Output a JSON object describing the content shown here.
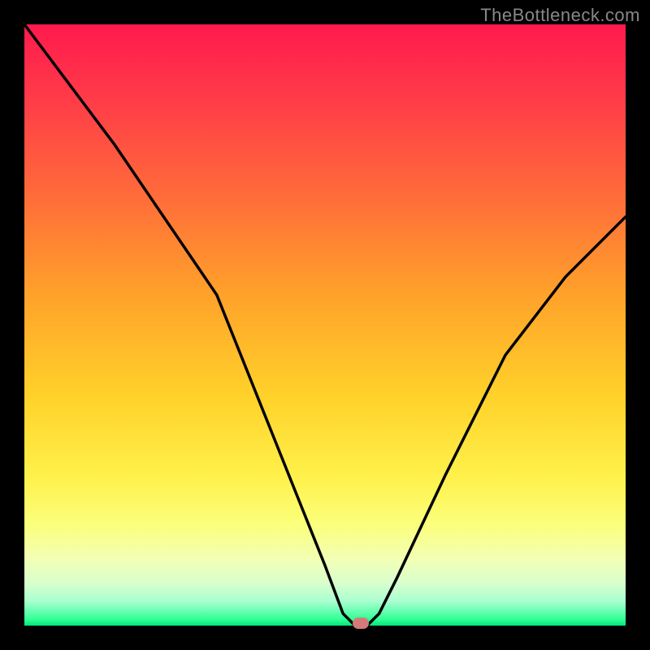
{
  "watermark": "TheBottleneck.com",
  "chart_data": {
    "type": "line",
    "title": "",
    "xlabel": "",
    "ylabel": "",
    "xlim": [
      0,
      100
    ],
    "ylim": [
      0,
      100
    ],
    "series": [
      {
        "name": "bottleneck-curve",
        "x": [
          0,
          15,
          32,
          44,
          50,
          53,
          55,
          57,
          59,
          62,
          70,
          80,
          90,
          100
        ],
        "values": [
          100,
          80,
          55,
          25,
          10,
          2,
          0,
          0,
          2,
          8,
          25,
          45,
          58,
          68
        ]
      }
    ],
    "marker": {
      "x": 56,
      "y": 0
    },
    "colors": {
      "curve": "#000000",
      "marker": "#d47a7a",
      "frame": "#000000"
    }
  }
}
